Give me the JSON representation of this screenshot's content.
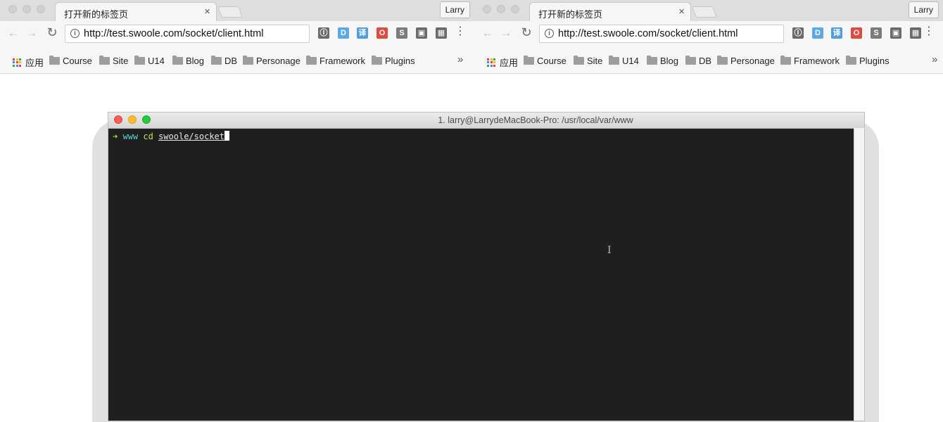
{
  "browsers": [
    {
      "tab_title": "打开新的标签页",
      "profile": "Larry",
      "url": "http://test.swoole.com/socket/client.html"
    },
    {
      "tab_title": "打开新的标签页",
      "profile": "Larry",
      "url": "http://test.swoole.com/socket/client.html"
    }
  ],
  "bookmarks": {
    "apps": "应用",
    "items": [
      "Course",
      "Site",
      "U14",
      "Blog",
      "DB",
      "Personage",
      "Framework",
      "Plugins"
    ],
    "more": "»"
  },
  "icons": {
    "back": "←",
    "forward": "→",
    "reload": "↻",
    "close": "×",
    "info": "i"
  },
  "extensions": [
    {
      "name": "dashlane-icon",
      "glyph": "Ⓘ",
      "color": "#6a6a6a"
    },
    {
      "name": "d-icon",
      "glyph": "D",
      "color": "#5aa9e6"
    },
    {
      "name": "translate-icon",
      "glyph": "译",
      "color": "#4d9de0"
    },
    {
      "name": "adblock-icon",
      "glyph": "O",
      "color": "#e04b3f"
    },
    {
      "name": "s-icon",
      "glyph": "S",
      "color": "#7b7b7b"
    },
    {
      "name": "ghost-icon",
      "glyph": "▣",
      "color": "#6a6a6a"
    },
    {
      "name": "qr-icon",
      "glyph": "▦",
      "color": "#6a6a6a"
    }
  ],
  "terminal": {
    "title": "1. larry@LarrydeMacBook-Pro: /usr/local/var/www",
    "prompt_arrow": "➜",
    "prompt_dir": "www",
    "command": "cd",
    "argument": "swoole/socket",
    "ibeam": "I"
  }
}
